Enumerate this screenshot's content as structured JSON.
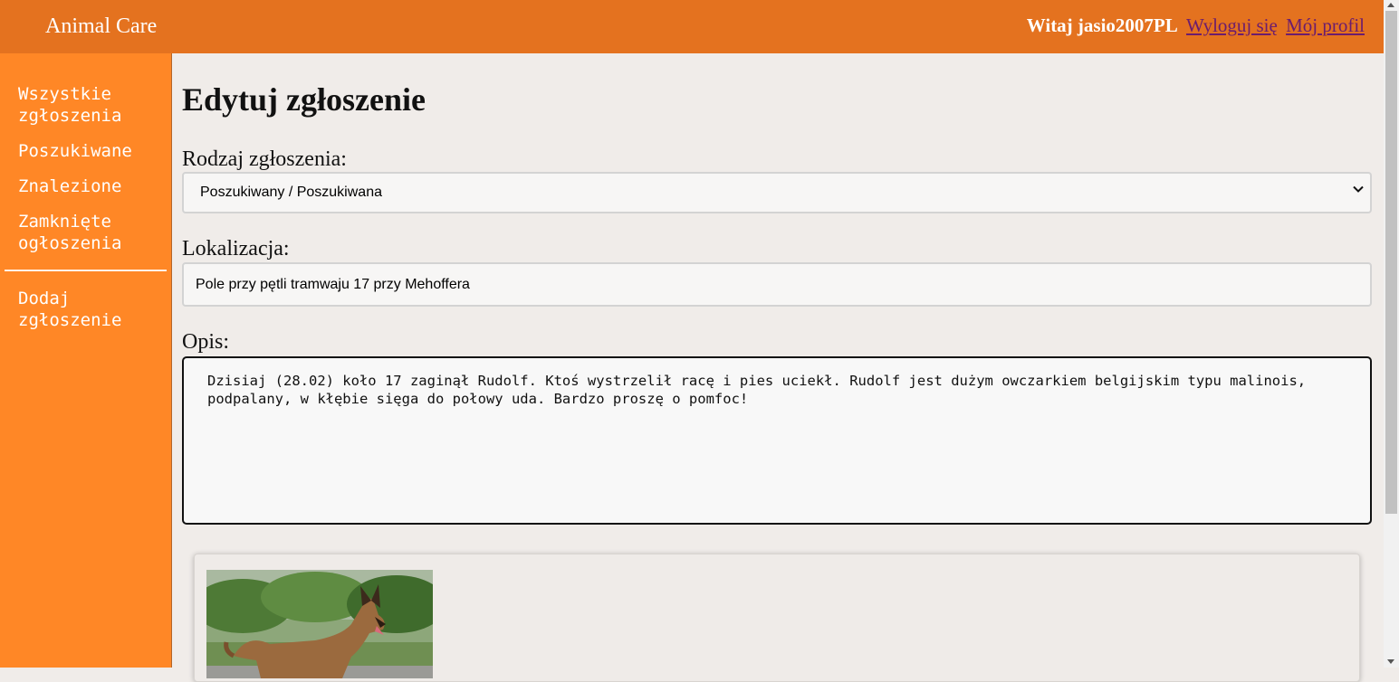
{
  "header": {
    "brand": "Animal Care",
    "welcome": "Witaj jasio2007PL",
    "logout": "Wyloguj się",
    "profile": "Mój profil"
  },
  "sidebar": {
    "items": [
      {
        "label": "Wszystkie zgłoszenia"
      },
      {
        "label": "Poszukiwane"
      },
      {
        "label": "Znalezione"
      },
      {
        "label": "Zamknięte ogłoszenia"
      }
    ],
    "add": "Dodaj zgłoszenie"
  },
  "form": {
    "title": "Edytuj zgłoszenie",
    "type_label": "Rodzaj zgłoszenia:",
    "type_value": "Poszukiwany / Poszukiwana",
    "location_label": "Lokalizacja:",
    "location_value": "Pole przy pętli tramwaju 17 przy Mehoffera",
    "description_label": "Opis:",
    "description_value": "Dzisiaj (28.02) koło 17 zaginął Rudolf. Ktoś wystrzelił racę i pies uciekł. Rudolf jest dużym owczarkiem belgijskim typu malinois, podpalany, w kłębie sięga do połowy uda. Bardzo proszę o pomfoc!"
  },
  "colors": {
    "topbar": "#e4721f",
    "sidebar": "#ff8726",
    "background": "#f0ece9",
    "link": "#6b1c6e"
  }
}
